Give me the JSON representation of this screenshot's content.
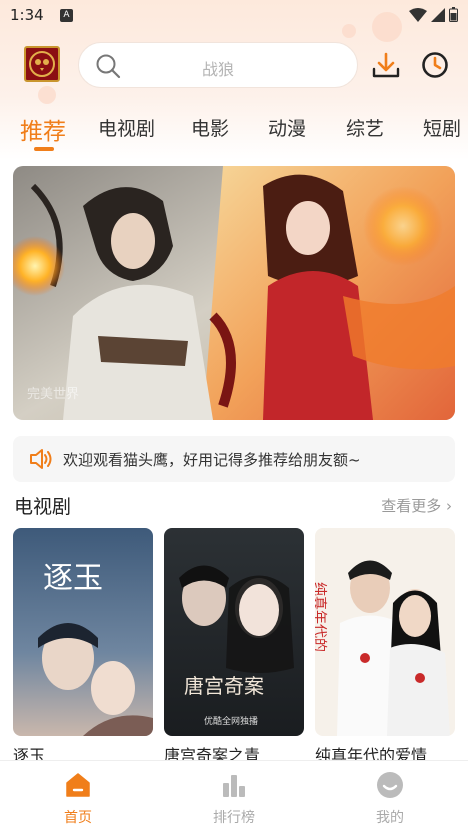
{
  "status_bar": {
    "time": "1:34",
    "notification_letter": "A"
  },
  "header": {
    "logo": "owl-logo",
    "search": {
      "placeholder": "战狼"
    },
    "download_icon": "download-icon",
    "history_icon": "clock-icon"
  },
  "tabs": [
    {
      "label": "推荐",
      "active": true
    },
    {
      "label": "电视剧"
    },
    {
      "label": "电影"
    },
    {
      "label": "动漫"
    },
    {
      "label": "综艺"
    },
    {
      "label": "短剧"
    }
  ],
  "banner": {
    "caption": "完美世界"
  },
  "notice": {
    "text": "欢迎观看猫头鹰，好用记得多推荐给朋友额~"
  },
  "section": {
    "title": "电视剧",
    "more": "查看更多 ›",
    "items": [
      {
        "title": "逐玉"
      },
      {
        "title": "唐宫奇案之青"
      },
      {
        "title": "纯真年代的爱情"
      }
    ]
  },
  "bottom_nav": [
    {
      "label": "首页",
      "icon": "home-icon",
      "active": true
    },
    {
      "label": "排行榜",
      "icon": "ranking-icon"
    },
    {
      "label": "我的",
      "icon": "profile-icon"
    }
  ],
  "colors": {
    "accent": "#f07e1a",
    "inactive": "#aaaaaa"
  }
}
